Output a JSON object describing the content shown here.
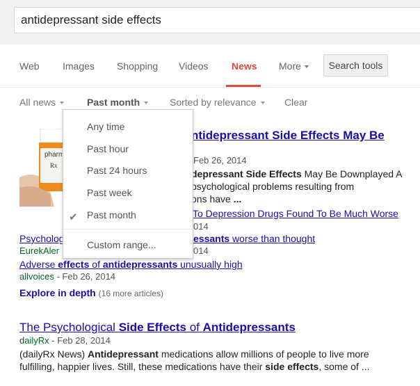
{
  "search": {
    "query": "antidepressant side effects"
  },
  "tabs": [
    "Web",
    "Images",
    "Shopping",
    "Videos",
    "News",
    "More"
  ],
  "active_tab": "News",
  "search_tools_label": "Search tools",
  "tools": {
    "all_news": "All news",
    "time": "Past month",
    "sort": "Sorted by relevance",
    "clear": "Clear"
  },
  "time_menu": {
    "options": [
      "Any time",
      "Past hour",
      "Past 24 hours",
      "Past week",
      "Past month"
    ],
    "selected": "Past month",
    "custom": "Custom range..."
  },
  "result1": {
    "title_visible": "ntidepressant Side Effects May Be",
    "date_visible": "Feb 26, 2014",
    "snippet_line1": "depressant Side Effects May Be Downplayed A",
    "snippet_line2": "psychological problems resulting from",
    "snippet_line3": "ons have ...",
    "related1": "To Depression Drugs Found To Be Much Worse",
    "related1_date": "014",
    "related2_prefix": "Psycholog",
    "related2_suffix": "worse than thought",
    "related2_bold": "essants",
    "related2_source": "EurekAler",
    "related2_date": "014",
    "related3": {
      "pre": "Adverse ",
      "b1": "effects",
      "mid": " of ",
      "b2": "antidepressants",
      "post": " unusually high"
    },
    "related3_source": "allvoices",
    "related3_date": "Feb 26, 2014",
    "explore": "Explore in depth",
    "explore_count": "(16 more articles)"
  },
  "result2": {
    "title": {
      "pre": "The Psychological ",
      "b1": "Side Effects",
      "mid": " of ",
      "b2": "Antidepressants"
    },
    "source": "dailyRx",
    "date": "Feb 28, 2014",
    "snippet": {
      "a": "(dailyRx News) ",
      "b": "Antidepressant",
      "c": " medications allow millions of people to live more",
      "d": "fulfilling, happier lives. Still, these medications have their ",
      "e": "side effects",
      "f": ", some of ..."
    }
  },
  "thumbnail_text": "pharm"
}
